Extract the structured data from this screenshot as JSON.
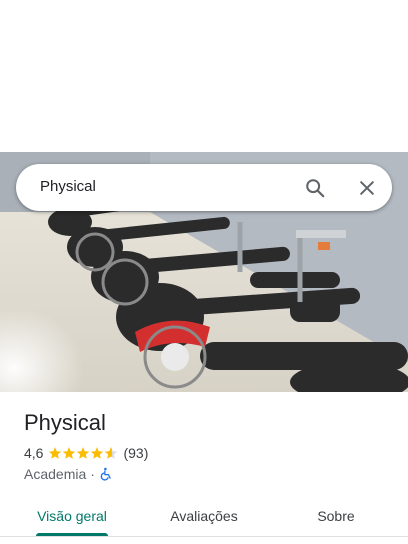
{
  "search": {
    "query": "Physical",
    "search_icon": "search-icon",
    "close_icon": "close-icon"
  },
  "place": {
    "name": "Physical",
    "rating": "4,6",
    "rating_value": 4.6,
    "reviews_count": "(93)",
    "category": "Academia",
    "separator": "·",
    "accessibility_icon": "wheelchair-icon"
  },
  "tabs": [
    {
      "label": "Visão geral",
      "active": true
    },
    {
      "label": "Avaliações",
      "active": false
    },
    {
      "label": "Sobre",
      "active": false
    }
  ],
  "colors": {
    "accent": "#00796b",
    "star": "#fbbc04",
    "accessibility": "#1a73e8"
  }
}
